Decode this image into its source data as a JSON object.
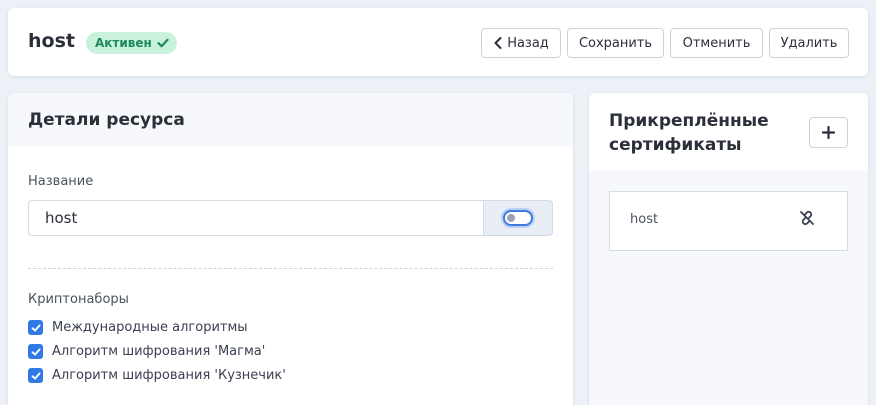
{
  "header": {
    "resource_name": "host",
    "status": "Активен",
    "buttons": {
      "back": "Назад",
      "save": "Сохранить",
      "cancel": "Отменить",
      "delete": "Удалить"
    }
  },
  "details": {
    "title": "Детали ресурса",
    "name_label": "Название",
    "name_value": "host",
    "toggle_on": false,
    "crypto_label": "Криптонаборы",
    "crypto_suites": [
      {
        "label": "Международные алгоритмы",
        "checked": true
      },
      {
        "label": "Алгоритм шифрования 'Магма'",
        "checked": true
      },
      {
        "label": "Алгоритм шифрования 'Кузнечик'",
        "checked": true
      }
    ]
  },
  "certificates": {
    "title": "Прикреплённые сертификаты",
    "items": [
      {
        "name": "host"
      }
    ]
  },
  "colors": {
    "accent": "#2f7ae5",
    "status_bg": "#c9f2dc",
    "status_text": "#1e8a5a",
    "page_bg": "#edf1f7"
  },
  "icons": {
    "status": "check-icon",
    "back": "chevron-left-icon",
    "add": "plus-icon",
    "unlink": "unlink-icon"
  }
}
